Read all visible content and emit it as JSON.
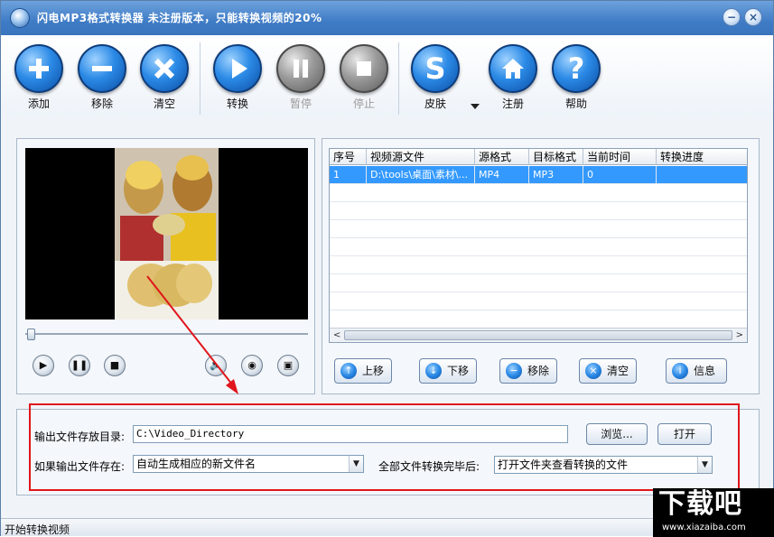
{
  "window": {
    "title": "闪电MP3格式转换器   未注册版本，只能转换视频的20%",
    "min_label": "−",
    "close_label": "×"
  },
  "toolbar": {
    "buttons": [
      {
        "label": "添加",
        "icon": "plus-icon",
        "enabled": true
      },
      {
        "label": "移除",
        "icon": "minus-icon",
        "enabled": true
      },
      {
        "label": "清空",
        "icon": "x-icon",
        "enabled": true
      },
      {
        "label": "转换",
        "icon": "play-icon",
        "enabled": true
      },
      {
        "label": "暂停",
        "icon": "pause-icon",
        "enabled": false
      },
      {
        "label": "停止",
        "icon": "stop-icon",
        "enabled": false
      },
      {
        "label": "皮肤",
        "icon": "skin-icon",
        "enabled": true
      },
      {
        "label": "注册",
        "icon": "home-icon",
        "enabled": true
      },
      {
        "label": "帮助",
        "icon": "help-icon",
        "enabled": true
      }
    ],
    "skin_glyph": "S",
    "help_glyph": "?"
  },
  "player": {
    "play_glyph": "▶",
    "pause_glyph": "❚❚",
    "stop_glyph": "■",
    "volume_glyph": "🔈",
    "snapshot_glyph": "◉",
    "folder_glyph": "▣",
    "seek_progress": 0
  },
  "file_list": {
    "columns": [
      "序号",
      "视频源文件",
      "源格式",
      "目标格式",
      "当前时间",
      "转换进度"
    ],
    "rows": [
      {
        "index": "1",
        "source": "D:\\tools\\桌面\\素材\\...",
        "src_format": "MP4",
        "dst_format": "MP3",
        "time": "0",
        "progress": ""
      }
    ],
    "scroll_left": "<",
    "scroll_right": ">"
  },
  "list_buttons": {
    "up": "上移",
    "down": "下移",
    "remove": "移除",
    "clear": "清空",
    "info": "信息",
    "up_glyph": "↑",
    "down_glyph": "↓",
    "remove_glyph": "−",
    "clear_glyph": "×",
    "info_glyph": "i"
  },
  "settings": {
    "output_dir_label": "输出文件存放目录:",
    "output_dir_value": "C:\\Video_Directory",
    "browse_button": "浏览...",
    "open_button": "打开",
    "exists_label": "如果输出文件存在:",
    "exists_value": "自动生成相应的新文件名",
    "after_label": "全部文件转换完毕后:",
    "after_value": "打开文件夹查看转换的文件",
    "dropdown_glyph": "▼"
  },
  "status_bar": {
    "text": "开始转换视频"
  },
  "watermark": {
    "text": "下载吧",
    "url": "www.xiazaiba.com"
  },
  "colors": {
    "title_bar": "#3f7cc6",
    "button_blue": "#2b8ae6",
    "selection": "#3399ff",
    "annotation_red": "#e0161c"
  }
}
